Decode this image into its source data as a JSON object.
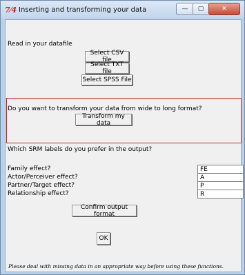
{
  "window": {
    "title": "Inserting and transforming your data",
    "icon_name": "tk-feather-icon",
    "icon_glyph": "7⁄4",
    "controls": {
      "minimize": "—",
      "maximize": "▢",
      "close": "✕"
    }
  },
  "read_section": {
    "label": "Read in your datafile",
    "buttons": [
      "Select CSV file",
      "Select TXT file",
      "Select SPSS File"
    ]
  },
  "transform_section": {
    "question": "Do you want to transform your data from wide to long format?",
    "button": "Transform my data"
  },
  "labels_section": {
    "question": "Which SRM labels do you prefer in the output?",
    "rows": [
      {
        "label": "Family effect?",
        "value": "FE"
      },
      {
        "label": "Actor/Perceiver effect?",
        "value": "A"
      },
      {
        "label": "Partner/Target effect?",
        "value": "P"
      },
      {
        "label": "Relationship effect?",
        "value": "R"
      }
    ],
    "confirm_button": "Confirm output format"
  },
  "ok_button": "OK",
  "footnote": "Please deal with missing data in an appropriate way before using these functions.",
  "colors": {
    "highlight_frame": "#d02020",
    "client_bg": "#f0f0f0",
    "frame_bg": "#b9d1ea"
  }
}
